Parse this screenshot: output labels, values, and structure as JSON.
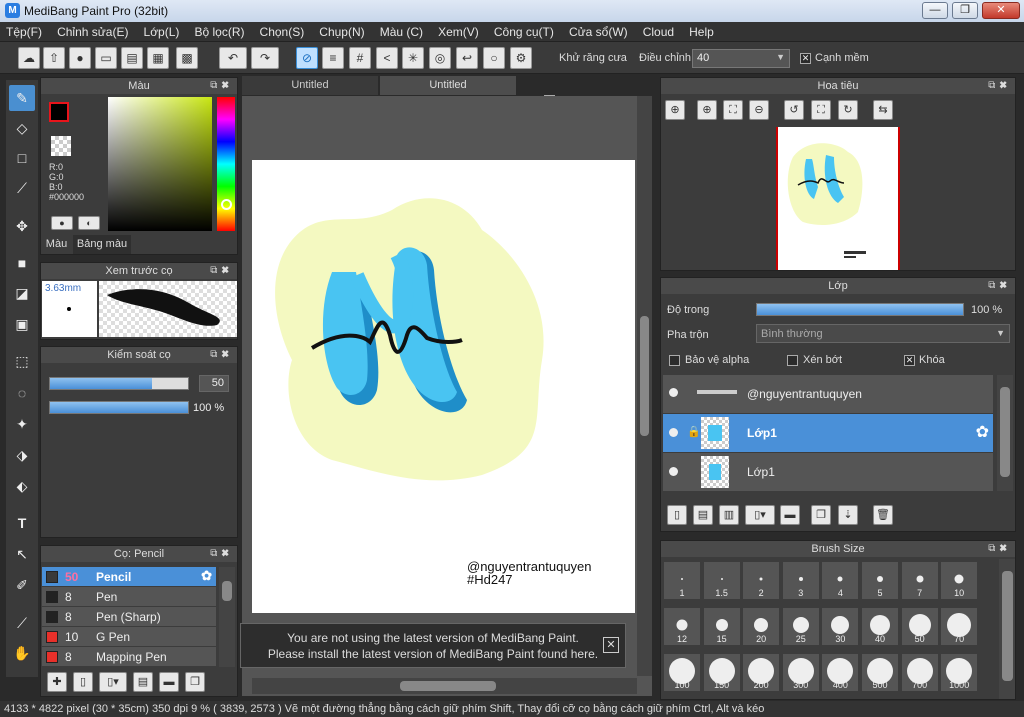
{
  "window": {
    "title": "MediBang Paint Pro (32bit)",
    "minimize": "—",
    "restore": "❐",
    "close": "✕"
  },
  "menu": [
    "Tệp(F)",
    "Chỉnh sửa(E)",
    "Lớp(L)",
    "Bộ lọc(R)",
    "Chọn(S)",
    "Chụp(N)",
    "Màu (C)",
    "Xem(V)",
    "Công cụ(T)",
    "Cửa sổ(W)",
    "Cloud",
    "Help"
  ],
  "toolbar": {
    "antialias_label": "Khử răng cưa",
    "correction_label": "Điều chỉnh",
    "correction_value": "40",
    "soft_edge_label": "Cạnh mềm",
    "antialias_checked": "✕",
    "soft_edge_checked": "✕"
  },
  "color_panel": {
    "title": "Màu",
    "r": "R:0",
    "g": "G:0",
    "b": "B:0",
    "hex": "#000000",
    "tab_color": "Màu",
    "tab_palette": "Bảng màu",
    "fg": "#e8141b",
    "bg": "#000000"
  },
  "brush_preview": {
    "title": "Xem trước cọ",
    "size": "3.63mm"
  },
  "brush_control": {
    "title": "Kiểm soát cọ",
    "size_value": "50",
    "size_fraction": 0.74,
    "opacity_value": "100 %",
    "opacity_fraction": 1.0
  },
  "brush_list": {
    "title": "Cọ: Pencil",
    "items": [
      {
        "size": "50",
        "name": "Pencil",
        "color": "#3a3a3a",
        "selected": true
      },
      {
        "size": "8",
        "name": "Pen",
        "color": "#222222",
        "selected": false
      },
      {
        "size": "8",
        "name": "Pen (Sharp)",
        "color": "#222222",
        "selected": false
      },
      {
        "size": "10",
        "name": "G Pen",
        "color": "#e8302a",
        "selected": false
      },
      {
        "size": "8",
        "name": "Mapping Pen",
        "color": "#e8302a",
        "selected": false
      }
    ]
  },
  "canvas": {
    "tabs": [
      "Untitled",
      "Untitled"
    ],
    "watermark_line1": "@nguyentrantuquyen",
    "watermark_line2": "#Hd247"
  },
  "notice": {
    "line1": "You are not using the latest version of MediBang Paint.",
    "line2": "Please install the latest version of MediBang Paint found here.",
    "close": "✕"
  },
  "navigator": {
    "title": "Hoa tiêu"
  },
  "layers": {
    "title": "Lớp",
    "opacity_label": "Độ trong",
    "opacity_value": "100 %",
    "opacity_fraction": 1.0,
    "blend_label": "Pha trộn",
    "blend_value": "Bình thường",
    "protect_alpha": "Bảo vệ alpha",
    "clipping": "Xén bớt",
    "lock": "Khóa",
    "lock_checked": "✕",
    "items": [
      {
        "name": "@nguyentrantuquyen",
        "selected": false
      },
      {
        "name": "Lớp1",
        "selected": true
      },
      {
        "name": "Lớp1",
        "selected": false
      }
    ]
  },
  "brush_size": {
    "title": "Brush Size",
    "sizes": [
      "1",
      "1.5",
      "2",
      "3",
      "4",
      "5",
      "7",
      "10",
      "12",
      "15",
      "20",
      "25",
      "30",
      "40",
      "50",
      "70",
      "100",
      "150",
      "200",
      "300",
      "400",
      "500",
      "700",
      "1000"
    ]
  },
  "status": {
    "text": "4133 * 4822 pixel   (30 * 35cm)   350 dpi   9 %   ( 3839, 2573 )   Vẽ một đường thẳng bằng cách giữ phím Shift, Thay đổi cỡ cọ bằng cách giữ phím Ctrl, Alt và kéo"
  }
}
